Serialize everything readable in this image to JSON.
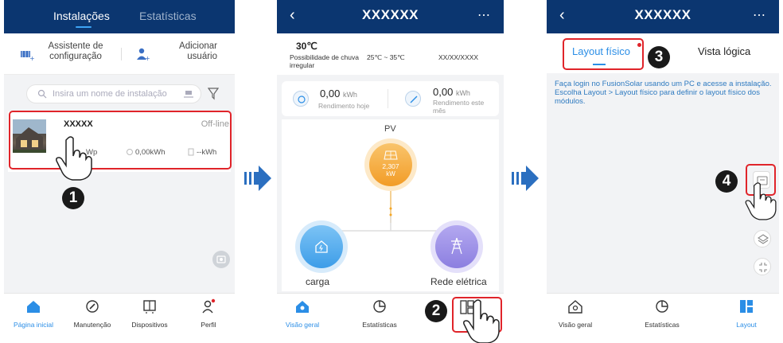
{
  "screen1": {
    "tabs": [
      "Instalações",
      "Estatísticas"
    ],
    "actions": [
      {
        "label": "Assistente de\nconfiguração",
        "icon": "setup-wizard-icon"
      },
      {
        "label": "Adicionar\nusuário",
        "icon": "add-user-icon"
      }
    ],
    "search_placeholder": "Insira um nome de instalação",
    "plant": {
      "name": "XXXXX",
      "status": "Off-line",
      "capacity": "Wp",
      "energy": "0,00kWh",
      "power": "--kWh"
    },
    "bottom_nav": [
      "Página inicial",
      "Manutenção",
      "Dispositivos",
      "Perfil"
    ],
    "step": "1"
  },
  "screen2": {
    "title": "XXXXXX",
    "temperature": "30℃",
    "weather_desc": "Possibilidade de chuva irregular",
    "temp_range": "25℃ ~ 35℃",
    "date": "XX/XX/XXXX",
    "yield_today": {
      "value": "0,00",
      "unit": "kWh",
      "label": "Rendimento hoje"
    },
    "yield_month": {
      "value": "0,00",
      "unit": "kWh",
      "label": "Rendimento este mês"
    },
    "pv_label": "PV",
    "pv_power": "2,307",
    "pv_unit": "kW",
    "load_label": "carga",
    "grid_label": "Rede elétrica",
    "bottom_nav": [
      "Visão geral",
      "Estatísticas"
    ],
    "step": "2"
  },
  "screen3": {
    "title": "XXXXXX",
    "tabs": [
      "Layout físico",
      "Vista lógica"
    ],
    "tip": "Faça login no FusionSolar usando um PC e acesse a instalação. Escolha Layout > Layout físico para definir o layout físico dos módulos.",
    "bottom_nav": [
      "Visão geral",
      "Estatísticas",
      "Layout"
    ],
    "step3": "3",
    "step4": "4"
  },
  "colors": {
    "navbar": "#0b3670",
    "accent": "#2e7ac0",
    "highlight": "#e0242a",
    "pv_node": "#f5a623",
    "load_node": "#3d9de8",
    "grid_node": "#8c7fe0"
  }
}
